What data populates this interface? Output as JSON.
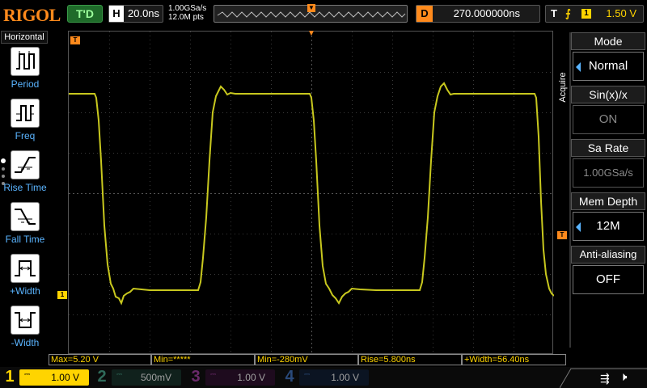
{
  "topbar": {
    "logo": "RIGOL",
    "run_status": "T'D",
    "horizontal": {
      "label": "H",
      "value": "20.0ns"
    },
    "sample_rate": "1.00GSa/s",
    "memory_points": "12.0M pts",
    "delay": {
      "label": "D",
      "value": "270.000000ns"
    },
    "trigger": {
      "label": "T",
      "edge": "⨍",
      "source": "1",
      "level": "1.50 V"
    }
  },
  "left_menu": {
    "title": "Horizontal",
    "items": [
      {
        "label": "Period",
        "icon": "period-icon"
      },
      {
        "label": "Freq",
        "icon": "freq-icon"
      },
      {
        "label": "Rise Time",
        "icon": "rise-time-icon"
      },
      {
        "label": "Fall Time",
        "icon": "fall-time-icon"
      },
      {
        "label": "+Width",
        "icon": "positive-width-icon"
      },
      {
        "label": "-Width",
        "icon": "negative-width-icon"
      }
    ]
  },
  "markers": {
    "trigger_position": "T",
    "channel1": "1",
    "trigger_level": "T"
  },
  "right_menu": {
    "section": "Acquire",
    "items": [
      {
        "title": "Mode",
        "value": "Normal",
        "arrow": true,
        "dim": false
      },
      {
        "title": "Sin(x)/x",
        "value": "ON",
        "arrow": false,
        "dim": true
      },
      {
        "title": "Sa Rate",
        "value": "1.00GSa/s",
        "arrow": false,
        "dim": true
      },
      {
        "title": "Mem Depth",
        "value": "12M",
        "arrow": true,
        "dim": false
      },
      {
        "title": "Anti-aliasing",
        "value": "OFF",
        "arrow": false,
        "dim": false
      }
    ]
  },
  "measurements": [
    "Max=5.20 V",
    "Min=*****",
    "Min=-280mV",
    "Rise=5.800ns",
    "+Width=56.40ns"
  ],
  "channels": [
    {
      "number": "1",
      "scale": "1.00 V",
      "active": true
    },
    {
      "number": "2",
      "scale": "500mV",
      "active": false
    },
    {
      "number": "3",
      "scale": "1.00 V",
      "active": false
    },
    {
      "number": "4",
      "scale": "1.00 V",
      "active": false
    }
  ],
  "colors": {
    "ch1": "#ffd400",
    "trace": "#c8c81e",
    "accent": "#ff8a1c",
    "menu_text": "#5ab4ff"
  }
}
